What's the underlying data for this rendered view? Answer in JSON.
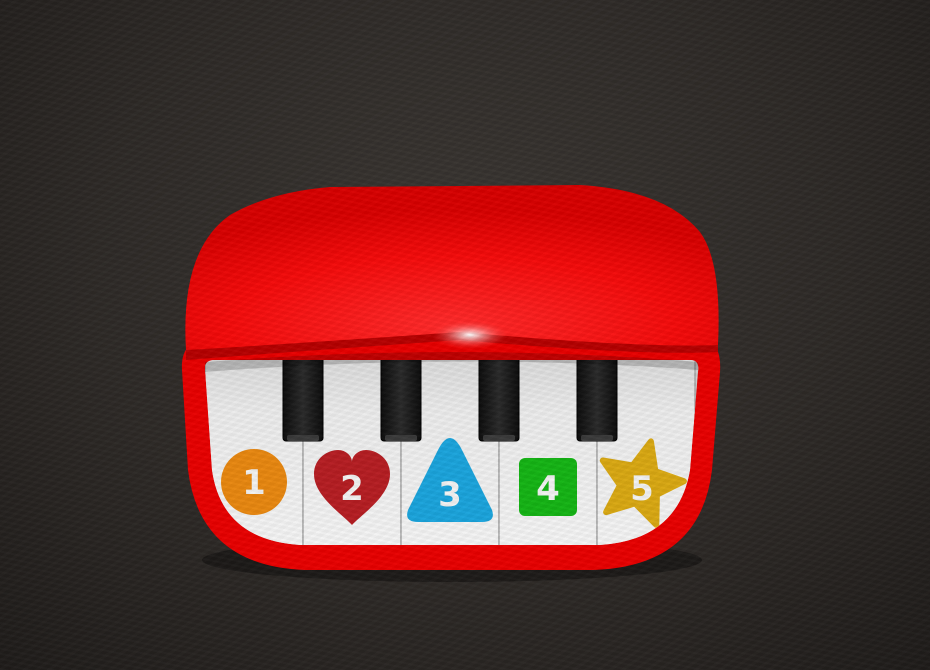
{
  "keys": [
    {
      "label": "1",
      "shape": "circle",
      "color": "#e8870f"
    },
    {
      "label": "2",
      "shape": "heart",
      "color": "#b51d22"
    },
    {
      "label": "3",
      "shape": "triangle",
      "color": "#1aa4dc"
    },
    {
      "label": "4",
      "shape": "square",
      "color": "#14b414"
    },
    {
      "label": "5",
      "shape": "star",
      "color": "#d9a812"
    }
  ],
  "colors": {
    "body": "#ff0e0e",
    "body_dark": "#c00000",
    "white_key": "#e8e8e8",
    "black_key": "#1a1a1a"
  }
}
